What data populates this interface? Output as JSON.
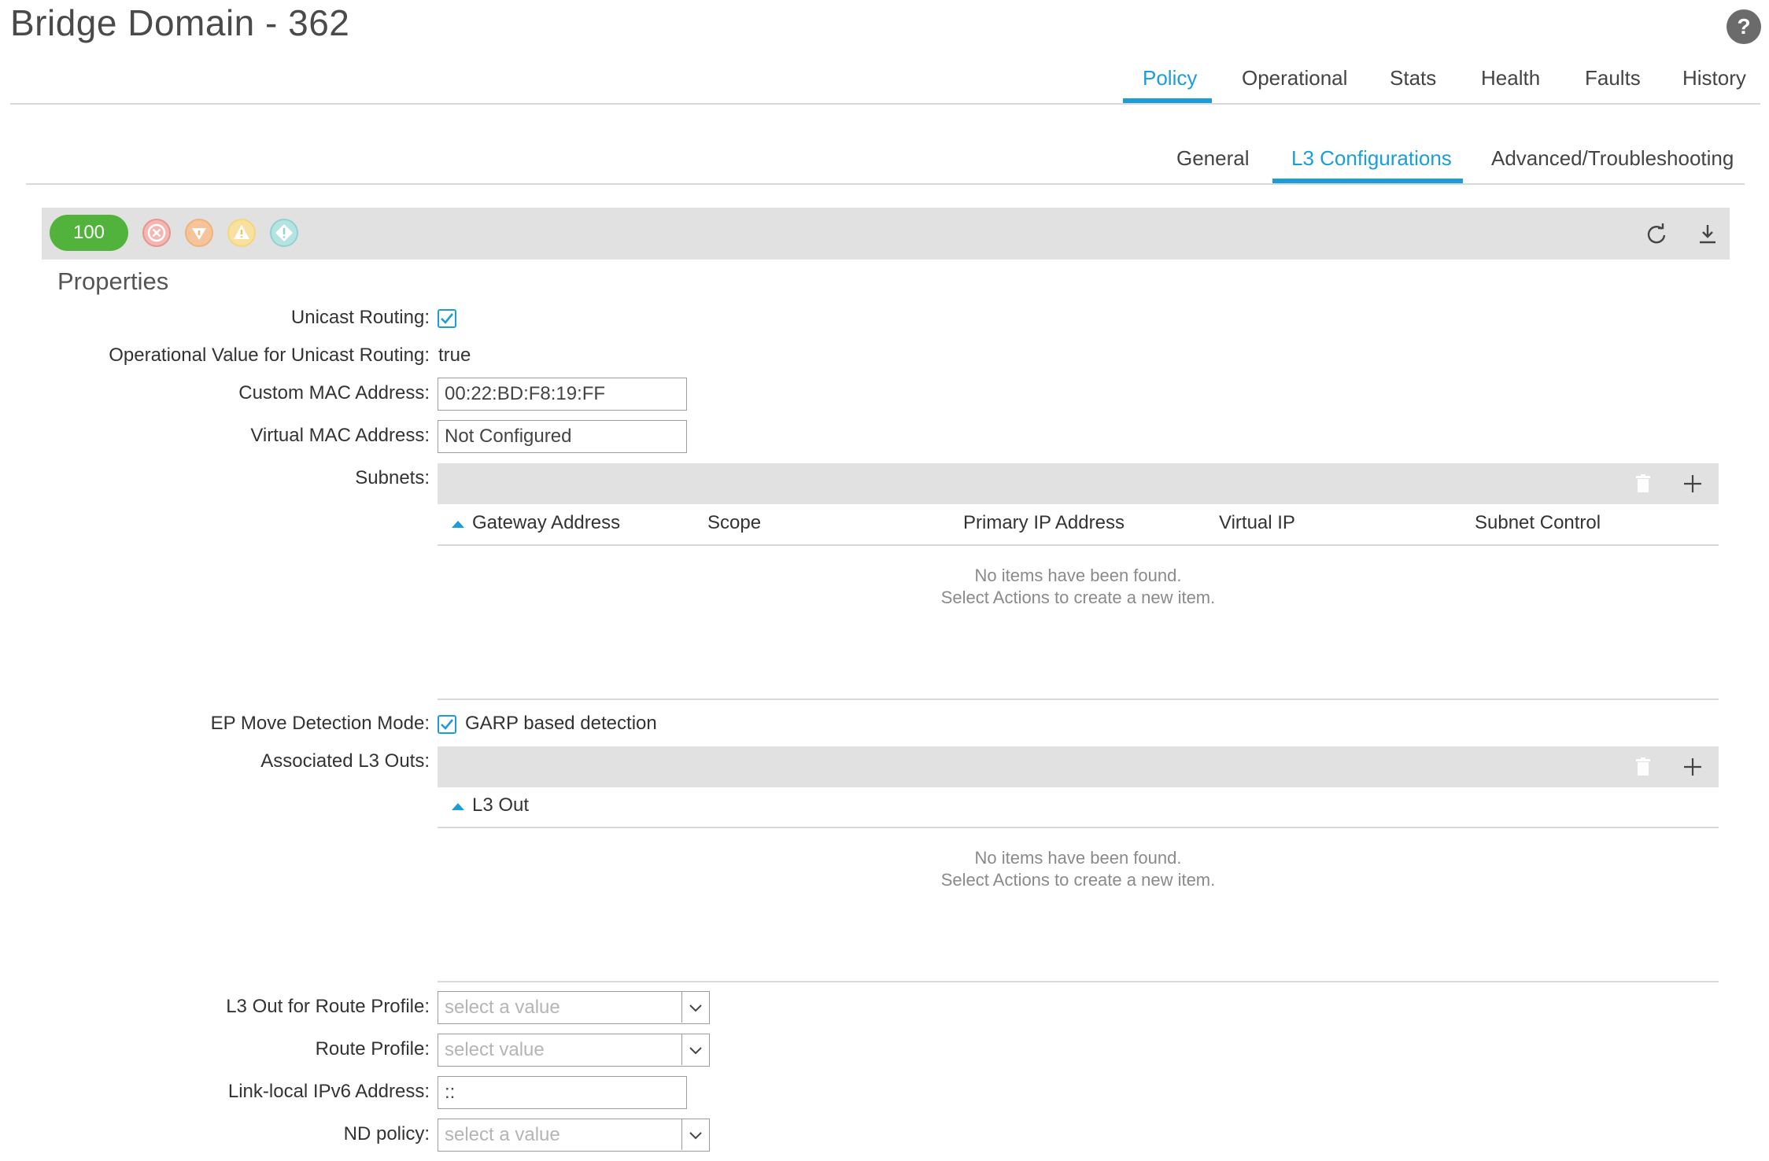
{
  "header": {
    "title": "Bridge Domain - 362",
    "help_icon": "?"
  },
  "tabs": [
    {
      "label": "Policy",
      "active": true
    },
    {
      "label": "Operational",
      "active": false
    },
    {
      "label": "Stats",
      "active": false
    },
    {
      "label": "Health",
      "active": false
    },
    {
      "label": "Faults",
      "active": false
    },
    {
      "label": "History",
      "active": false
    }
  ],
  "subtabs": [
    {
      "label": "General",
      "active": false
    },
    {
      "label": "L3 Configurations",
      "active": true
    },
    {
      "label": "Advanced/Troubleshooting",
      "active": false
    }
  ],
  "toolbar": {
    "health_score": "100",
    "severity_icons": [
      "critical-icon",
      "major-icon",
      "minor-icon",
      "warning-icon"
    ],
    "refresh_icon": "refresh-icon",
    "download_icon": "download-icon"
  },
  "properties": {
    "title": "Properties",
    "unicast_routing": {
      "label": "Unicast Routing:",
      "checked": true
    },
    "operational_unicast": {
      "label": "Operational Value for Unicast Routing:",
      "value": "true"
    },
    "custom_mac": {
      "label": "Custom MAC Address:",
      "value": "00:22:BD:F8:19:FF"
    },
    "virtual_mac": {
      "label": "Virtual MAC Address:",
      "value": "Not Configured"
    },
    "subnets": {
      "label": "Subnets:",
      "columns": [
        "Gateway Address",
        "Scope",
        "Primary IP Address",
        "Virtual IP",
        "Subnet Control"
      ],
      "empty_line1": "No items have been found.",
      "empty_line2": "Select Actions to create a new item."
    },
    "ep_move": {
      "label": "EP Move Detection Mode:",
      "option": "GARP based detection",
      "checked": true
    },
    "l3outs": {
      "label": "Associated L3 Outs:",
      "columns": [
        "L3 Out"
      ],
      "empty_line1": "No items have been found.",
      "empty_line2": "Select Actions to create a new item."
    },
    "l3out_route_profile": {
      "label": "L3 Out for Route Profile:",
      "placeholder": "select a value"
    },
    "route_profile": {
      "label": "Route Profile:",
      "placeholder": "select value"
    },
    "link_local_ipv6": {
      "label": "Link-local IPv6 Address:",
      "value": "::"
    },
    "nd_policy": {
      "label": "ND policy:",
      "placeholder": "select a value"
    }
  },
  "colors": {
    "accent": "#1b9ed8",
    "health_green": "#52b33c",
    "critical": "#e8948e",
    "major": "#f0b27a",
    "minor": "#f5d77a",
    "warning": "#8fd3d0"
  }
}
